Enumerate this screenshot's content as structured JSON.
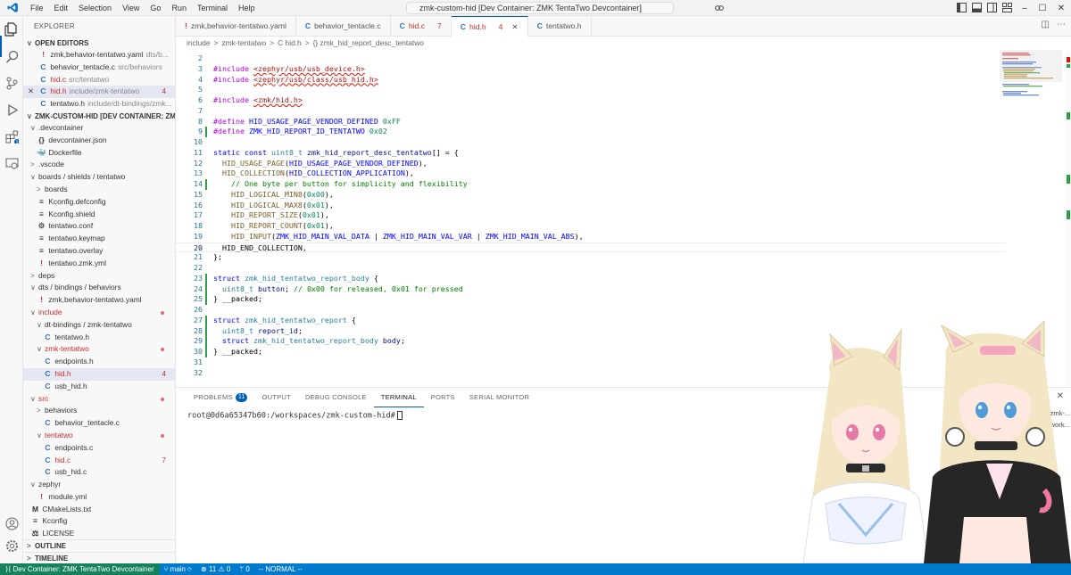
{
  "menu": [
    "File",
    "Edit",
    "Selection",
    "View",
    "Go",
    "Run",
    "Terminal",
    "Help"
  ],
  "window_title": "zmk-custom-hid [Dev Container: ZMK TentaTwo Devcontainer]",
  "explorer": {
    "title": "EXPLORER",
    "open_editors_label": "OPEN EDITORS",
    "open_editors": [
      {
        "icon": "!",
        "name": "zmk,behavior-tentatwo.yaml",
        "desc": "dts/b...",
        "kind": "yaml",
        "close": false
      },
      {
        "icon": "C",
        "name": "behavior_tentacle.c",
        "desc": "src/behaviors",
        "kind": "c",
        "close": false
      },
      {
        "icon": "C",
        "name": "hid.c",
        "desc": "src/tentatwo",
        "kind": "c",
        "close": false,
        "red": true,
        "badge": ""
      },
      {
        "icon": "C",
        "name": "hid.h",
        "desc": "include/zmk-tentatwo",
        "kind": "c",
        "close": true,
        "red": true,
        "badge": "4",
        "selected": true
      },
      {
        "icon": "C",
        "name": "tentatwo.h",
        "desc": "include/dt-bindings/zmk...",
        "kind": "c",
        "close": false
      }
    ],
    "workspace_label": "ZMK-CUSTOM-HID [DEV CONTAINER: ZMK TE...",
    "tree": [
      {
        "depth": 0,
        "chev": "∨",
        "name": ".devcontainer"
      },
      {
        "depth": 1,
        "icon": "{}",
        "name": "devcontainer.json"
      },
      {
        "depth": 1,
        "icon": "🐳",
        "name": "Dockerfile"
      },
      {
        "depth": 0,
        "chev": ">",
        "name": ".vscode"
      },
      {
        "depth": 0,
        "chev": "∨",
        "name": "boards / shields / tentatwo"
      },
      {
        "depth": 1,
        "chev": ">",
        "name": "boards"
      },
      {
        "depth": 1,
        "icon": "≡",
        "name": "Kconfig.defconfig"
      },
      {
        "depth": 1,
        "icon": "≡",
        "name": "Kconfig.shield"
      },
      {
        "depth": 1,
        "icon": "⚙",
        "name": "tentatwo.conf"
      },
      {
        "depth": 1,
        "icon": "≡",
        "name": "tentatwo.keymap"
      },
      {
        "depth": 1,
        "icon": "≡",
        "name": "tentatwo.overlay"
      },
      {
        "depth": 1,
        "icon": "!",
        "name": "tentatwo.zmk.yml"
      },
      {
        "depth": 0,
        "chev": ">",
        "name": "deps"
      },
      {
        "depth": 0,
        "chev": "∨",
        "name": "dts / bindings / behaviors"
      },
      {
        "depth": 1,
        "icon": "!",
        "name": "zmk,behavior-tentatwo.yaml"
      },
      {
        "depth": 0,
        "chev": "∨",
        "name": "include",
        "red": true,
        "dot": true
      },
      {
        "depth": 1,
        "chev": "∨",
        "name": "dt-bindings / zmk-tentatwo"
      },
      {
        "depth": 2,
        "icon": "C",
        "name": "tentatwo.h"
      },
      {
        "depth": 1,
        "chev": "∨",
        "name": "zmk-tentatwo",
        "red": true,
        "dot": true
      },
      {
        "depth": 2,
        "icon": "C",
        "name": "endpoints.h"
      },
      {
        "depth": 2,
        "icon": "C",
        "name": "hid.h",
        "red": true,
        "badge": "4",
        "selected": true
      },
      {
        "depth": 2,
        "icon": "C",
        "name": "usb_hid.h"
      },
      {
        "depth": 0,
        "chev": "∨",
        "name": "src",
        "red": true,
        "dot": true
      },
      {
        "depth": 1,
        "chev": ">",
        "name": "behaviors"
      },
      {
        "depth": 2,
        "icon": "C",
        "name": "behavior_tentacle.c"
      },
      {
        "depth": 1,
        "chev": "∨",
        "name": "tentatwo",
        "red": true,
        "dot": true
      },
      {
        "depth": 2,
        "icon": "C",
        "name": "endpoints.c"
      },
      {
        "depth": 2,
        "icon": "C",
        "name": "hid.c",
        "red": true,
        "badge": "7"
      },
      {
        "depth": 2,
        "icon": "C",
        "name": "usb_hid.c"
      },
      {
        "depth": 0,
        "chev": "∨",
        "name": "zephyr"
      },
      {
        "depth": 1,
        "icon": "!",
        "name": "module.yml"
      },
      {
        "depth": 0,
        "icon": "M",
        "name": "CMakeLists.txt"
      },
      {
        "depth": 0,
        "icon": "≡",
        "name": "Kconfig"
      },
      {
        "depth": 0,
        "icon": "⚖",
        "name": "LICENSE"
      }
    ],
    "outline_label": "OUTLINE",
    "timeline_label": "TIMELINE"
  },
  "tabs": [
    {
      "icon": "!",
      "label": "zmk,behavior-tentatwo.yaml"
    },
    {
      "icon": "C",
      "label": "behavior_tentacle.c"
    },
    {
      "icon": "C",
      "label": "hid.c",
      "red": true,
      "badge": "7"
    },
    {
      "icon": "C",
      "label": "hid.h",
      "red": true,
      "badge": "4",
      "active": true
    },
    {
      "icon": "C",
      "label": "tentatwo.h"
    }
  ],
  "breadcrumb": [
    "include",
    ">",
    "zmk-tentatwo",
    ">",
    "C hid.h",
    ">",
    "{} zmk_hid_report_desc_tentatwo"
  ],
  "code_lines": [
    {
      "n": "2",
      "html": ""
    },
    {
      "n": "3",
      "html": "<span class='k-pre'>#include</span> <span class='k-inc squig'>&lt;zephyr/usb/usb_device.h&gt;</span>"
    },
    {
      "n": "4",
      "html": "<span class='k-pre'>#include</span> <span class='k-inc squig'>&lt;zephyr/usb/class/usb_hid.h&gt;</span>"
    },
    {
      "n": "5",
      "html": ""
    },
    {
      "n": "6",
      "html": "<span class='k-pre'>#include</span> <span class='k-inc squig'>&lt;zmk/hid.h&gt;</span>"
    },
    {
      "n": "7",
      "html": ""
    },
    {
      "n": "8",
      "html": "<span class='k-pre'>#define</span> <span class='k-mac'>HID_USAGE_PAGE_VENDOR_DEFINED</span> <span class='k-num'>0xFF</span>"
    },
    {
      "n": "9",
      "html": "<span class='k-pre'>#define</span> <span class='k-mac'>ZMK_HID_REPORT_ID_TENTATWO</span> <span class='k-num'>0x02</span>",
      "bar": true
    },
    {
      "n": "10",
      "html": ""
    },
    {
      "n": "11",
      "html": "<span class='k-kw'>static</span> <span class='k-kw'>const</span> <span class='k-typ'>uint8_t</span> <span class='k-id'>zmk_hid_report_desc_tentatwo</span><span class='k-txt'>[] = {</span>"
    },
    {
      "n": "12",
      "html": "  <span class='k-fn'>HID_USAGE_PAGE</span><span class='k-txt'>(</span><span class='k-mac'>HID_USAGE_PAGE_VENDOR_DEFINED</span><span class='k-txt'>),</span>"
    },
    {
      "n": "13",
      "html": "  <span class='k-fn'>HID_COLLECTION</span><span class='k-txt'>(</span><span class='k-mac'>HID_COLLECTION_APPLICATION</span><span class='k-txt'>),</span>"
    },
    {
      "n": "14",
      "html": "    <span class='k-cm'>// One byte per button for simplicity and flexibility</span>",
      "bar": true
    },
    {
      "n": "15",
      "html": "    <span class='k-fn'>HID_LOGICAL_MIN8</span><span class='k-txt'>(</span><span class='k-num'>0x00</span><span class='k-txt'>),</span>"
    },
    {
      "n": "16",
      "html": "    <span class='k-fn'>HID_LOGICAL_MAX8</span><span class='k-txt'>(</span><span class='k-num'>0x01</span><span class='k-txt'>),</span>"
    },
    {
      "n": "17",
      "html": "    <span class='k-fn'>HID_REPORT_SIZE</span><span class='k-txt'>(</span><span class='k-num'>0x01</span><span class='k-txt'>),</span>"
    },
    {
      "n": "18",
      "html": "    <span class='k-fn'>HID_REPORT_COUNT</span><span class='k-txt'>(</span><span class='k-num'>0x01</span><span class='k-txt'>),</span>"
    },
    {
      "n": "19",
      "html": "    <span class='k-fn'>HID_INPUT</span><span class='k-txt'>(</span><span class='k-mac'>ZMK_HID_MAIN_VAL_DATA</span> <span class='k-txt'>|</span> <span class='k-mac'>ZMK_HID_MAIN_VAL_VAR</span> <span class='k-txt'>|</span> <span class='k-mac'>ZMK_HID_MAIN_VAL_ABS</span><span class='k-txt'>),</span>"
    },
    {
      "n": "20",
      "html": "  <span class='k-txt'>HID_END_COLLECTION,</span>",
      "cur": true
    },
    {
      "n": "21",
      "html": "<span class='k-txt'>};</span>"
    },
    {
      "n": "22",
      "html": ""
    },
    {
      "n": "23",
      "html": "<span class='k-kw'>struct</span> <span class='k-typ'>zmk_hid_tentatwo_report_body</span> <span class='k-txt'>{</span>",
      "bar": true
    },
    {
      "n": "24",
      "html": "  <span class='k-typ'>uint8_t</span> <span class='k-id'>button</span><span class='k-txt'>;</span> <span class='k-cm'>// 0x00 for released, 0x01 for pressed</span>",
      "bar": true
    },
    {
      "n": "25",
      "html": "<span class='k-txt'>} __packed;</span>",
      "bar": true
    },
    {
      "n": "26",
      "html": ""
    },
    {
      "n": "27",
      "html": "<span class='k-kw'>struct</span> <span class='k-typ'>zmk_hid_tentatwo_report</span> <span class='k-txt'>{</span>",
      "bar": true
    },
    {
      "n": "28",
      "html": "  <span class='k-typ'>uint8_t</span> <span class='k-id'>report_id</span><span class='k-txt'>;</span>",
      "bar": true
    },
    {
      "n": "29",
      "html": "  <span class='k-kw'>struct</span> <span class='k-typ'>zmk_hid_tentatwo_report_body</span> <span class='k-id'>body</span><span class='k-txt'>;</span>",
      "bar": true
    },
    {
      "n": "30",
      "html": "<span class='k-txt'>} __packed;</span>",
      "bar": true
    },
    {
      "n": "31",
      "html": ""
    },
    {
      "n": "32",
      "html": ""
    }
  ],
  "panel": {
    "tabs": [
      {
        "label": "PROBLEMS",
        "badge": "11"
      },
      {
        "label": "OUTPUT"
      },
      {
        "label": "DEBUG CONSOLE"
      },
      {
        "label": "TERMINAL",
        "active": true
      },
      {
        "label": "PORTS"
      },
      {
        "label": "SERIAL MONITOR"
      }
    ],
    "terminal_prompt": "root@0d6a65347b60:/workspaces/zmk-custom-hid#",
    "terminal_list": [
      "bash zmk-...",
      "bash work..."
    ]
  },
  "status": {
    "remote": "Dev Container: ZMK TentaTwo Devcontainer",
    "branch": "main",
    "errors": "11",
    "warnings": "0",
    "ports": "0",
    "vim_mode": "-- NORMAL --"
  },
  "colors": {
    "accent": "#005fb8",
    "statusbar": "#007acc",
    "remote": "#16825d",
    "error": "#c72e2e",
    "added": "#2ea043"
  }
}
